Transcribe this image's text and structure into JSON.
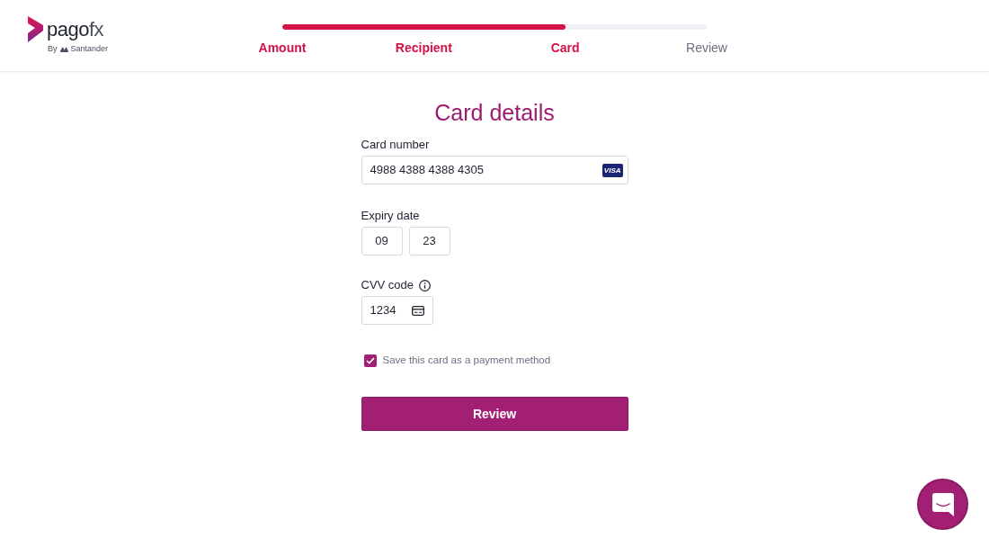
{
  "brand": {
    "name": "pago",
    "name_suffix": "fx",
    "tagline_prefix": "By",
    "tagline": "Santander"
  },
  "progress": {
    "level": 0.667,
    "steps": [
      {
        "label": "Amount",
        "completed": true
      },
      {
        "label": "Recipient",
        "completed": true
      },
      {
        "label": "Card",
        "completed": true
      },
      {
        "label": "Review",
        "completed": false
      }
    ]
  },
  "title": "Card details",
  "card_number": {
    "label": "Card number",
    "value": "4988 4388 4388 4305",
    "brand": "VISA"
  },
  "expiry": {
    "label": "Expiry date",
    "month": "09",
    "year": "23"
  },
  "cvv": {
    "label": "CVV code",
    "value": "1234"
  },
  "save_card": {
    "label": "Save this card as a payment method",
    "checked": true
  },
  "submit_button": "Review"
}
